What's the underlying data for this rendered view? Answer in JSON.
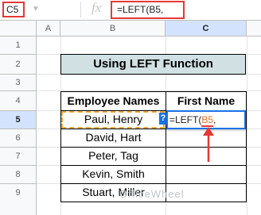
{
  "name_box": "C5",
  "fx_label": "fx",
  "formula_bar": "=LEFT(B5, ",
  "columns": [
    "A",
    "B",
    "C"
  ],
  "rows": [
    "1",
    "2",
    "3",
    "4",
    "5",
    "6",
    "7",
    "8",
    "9"
  ],
  "title": "Using LEFT Function",
  "headers": {
    "b": "Employee Names",
    "c": "First Name"
  },
  "employees": [
    "Paul, Henry",
    "David, Hart",
    "Peter, Tag",
    "Kevin, Smith",
    "Stuart, Miller"
  ],
  "editor": {
    "prefix": "=LEFT(",
    "ref": "B5",
    "suffix": ", "
  },
  "help_mark": "?",
  "watermark": "OfficeWheel",
  "colors": {
    "title_fill": "#d0e0e3",
    "accent_red": "#e53935",
    "edit_blue": "#1a73e8",
    "ref_orange": "#e8711a"
  }
}
